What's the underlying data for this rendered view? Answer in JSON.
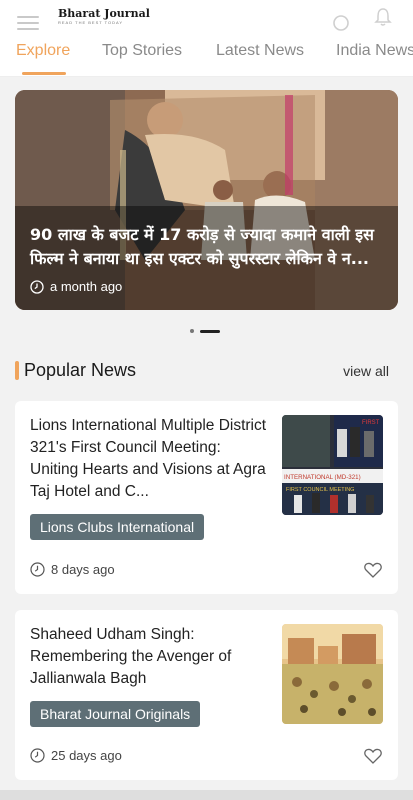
{
  "app": {
    "logo_title": "Bharat Journal",
    "logo_tagline": "READ THE BEST TODAY"
  },
  "tabs": [
    {
      "label": "Explore",
      "active": true
    },
    {
      "label": "Top Stories",
      "active": false
    },
    {
      "label": "Latest News",
      "active": false
    },
    {
      "label": "India News",
      "active": false
    }
  ],
  "hero": {
    "title": "90 लाख के बजट में 17 करोड़ से ज्यादा कमाने वाली इस फिल्म ने बनाया था इस एक्टर को सुपरस्टार लेकिन वे न...",
    "time": "a month ago",
    "pager": {
      "count": 2,
      "active_index": 1
    }
  },
  "section": {
    "title": "Popular News",
    "view_all": "view all"
  },
  "articles": [
    {
      "title": "Lions International Multiple District 321's First Council Meeting: Uniting Hearts and Visions at Agra Taj Hotel and C...",
      "tag": "Lions Clubs International",
      "time": "8 days ago",
      "thumb_caption_top": "FIRST",
      "thumb_caption_mid": "INTERNATIONAL (MD-321)",
      "thumb_caption_low": "FIRST COUNCIL MEETING"
    },
    {
      "title": "Shaheed Udham Singh: Remembering the Avenger of Jallianwala Bagh",
      "tag": "Bharat Journal Originals",
      "time": "25 days ago"
    }
  ],
  "colors": {
    "accent": "#f0a45c",
    "chip": "#5e6f76",
    "background": "#f2f2f2"
  }
}
